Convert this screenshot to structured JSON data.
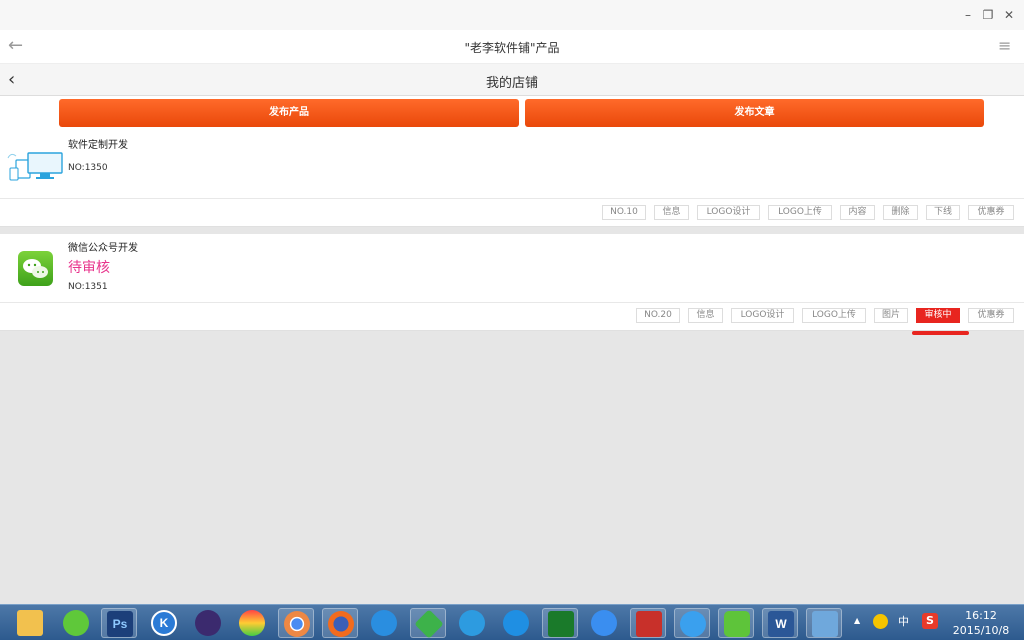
{
  "window": {
    "min_glyph": "–",
    "max_glyph": "❐",
    "close_glyph": "✕"
  },
  "appbar": {
    "title": "\"老李软件铺\"产品",
    "back_glyph": "←",
    "menu_glyph": "≡"
  },
  "pagebar": {
    "title": "我的店铺",
    "back_glyph": "‹"
  },
  "actions": {
    "publish_product": "发布产品",
    "publish_article": "发布文章"
  },
  "products": [
    {
      "title": "软件定制开发",
      "no": "NO:1350",
      "status": "",
      "icon": "devices-icon",
      "tags": [
        "NO.10",
        "信息",
        "LOGO设计",
        "LOGO上传",
        "内容",
        "删除",
        "下线",
        "优惠券"
      ]
    },
    {
      "title": "微信公众号开发",
      "no": "NO:1351",
      "status": "待审核",
      "icon": "wechat-icon",
      "tags": [
        "NO.20",
        "信息",
        "LOGO设计",
        "LOGO上传",
        "图片",
        "审核中",
        "优惠券"
      ]
    }
  ],
  "colors": {
    "accent_orange": "#f05a1a",
    "active_red": "#e8251f",
    "pending_pink": "#e8348c"
  },
  "taskbar": {
    "apps": [
      "file-explorer-icon",
      "leaf-app-icon",
      "photoshop-icon",
      "k-app-icon",
      "eclipse-icon",
      "color-app-icon",
      "chrome-icon",
      "firefox-icon",
      "ie-icon",
      "green-diamond-icon",
      "cloud-app-icon",
      "network-app-icon",
      "eye-app-icon",
      "pen-app-icon",
      "house-app-icon",
      "ie-icon-2",
      "wechat-icon",
      "word-icon",
      "computer-icon"
    ],
    "ps_label": "Ps",
    "k_label": "K",
    "word_label": "W",
    "tray_up": "▲",
    "tray_ime": "中",
    "tray_s": "S",
    "time": "16:12",
    "date": "2015/10/8"
  }
}
